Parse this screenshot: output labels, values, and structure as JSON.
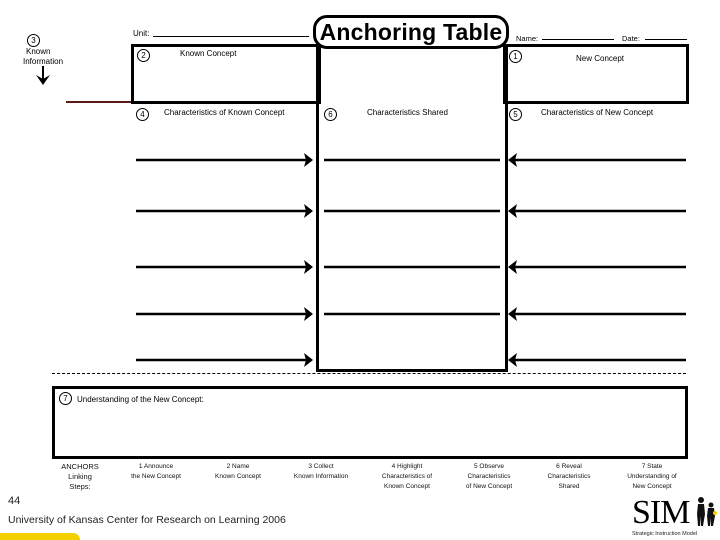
{
  "header": {
    "title": "Anchoring Table",
    "unit_label": "Unit:",
    "name_label": "Name:",
    "date_label": "Date:"
  },
  "known_information": {
    "number": "3",
    "label_line1": "Known",
    "label_line2": "Information",
    "icon": "arrow-down-icon"
  },
  "sections": {
    "known_concept": {
      "number": "2",
      "label": "Known Concept"
    },
    "new_concept": {
      "number": "1",
      "label": "New Concept"
    },
    "char_known": {
      "number": "4",
      "label": "Characteristics of Known Concept"
    },
    "char_shared": {
      "number": "6",
      "label": "Characteristics Shared"
    },
    "char_new": {
      "number": "5",
      "label": "Characteristics of New Concept"
    },
    "understanding": {
      "number": "7",
      "label": "Understanding of the New Concept:"
    }
  },
  "rows": {
    "count": 5
  },
  "linking_steps": {
    "header": [
      "ANCHORS",
      "Linking",
      "Steps:"
    ],
    "steps": [
      {
        "line1": "1 Announce",
        "line2": "the New Concept",
        "line3": ""
      },
      {
        "line1": "2 Name",
        "line2": "Known Concept",
        "line3": ""
      },
      {
        "line1": "3 Collect",
        "line2": "Known Information",
        "line3": ""
      },
      {
        "line1": "4 Highlight",
        "line2": "Characteristics of",
        "line3": "Known Concept"
      },
      {
        "line1": "5 Observe",
        "line2": "Characteristics",
        "line3": "of New Concept"
      },
      {
        "line1": "6 Reveal",
        "line2": "Characteristics",
        "line3": "Shared"
      },
      {
        "line1": "7 State",
        "line2": "Understanding of",
        "line3": "New Concept"
      }
    ]
  },
  "footer": {
    "page_number": "44",
    "credit": "University of Kansas Center for Research on Learning 2006",
    "logo_text": "SIM",
    "logo_subtitle": "Strategic Instruction Model",
    "accent_color": "#f5d000",
    "divider_color": "#5a1a1a"
  }
}
